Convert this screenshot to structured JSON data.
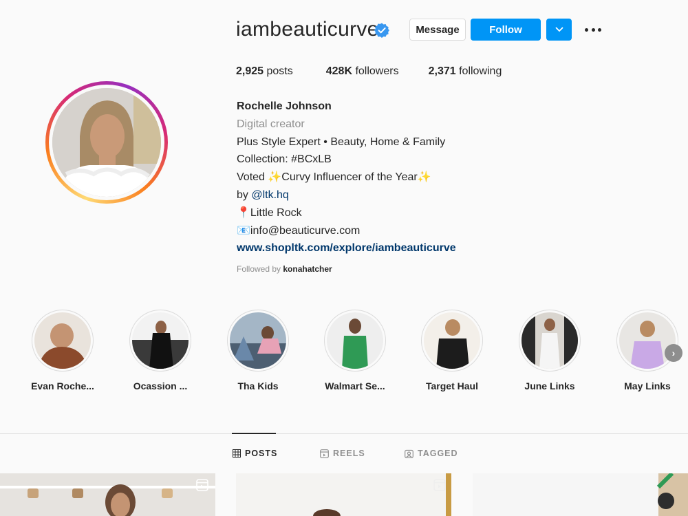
{
  "profile": {
    "username": "iambeauticurve",
    "verified": true,
    "buttons": {
      "message": "Message",
      "follow": "Follow"
    },
    "stats": {
      "posts_count": "2,925",
      "posts_label": "posts",
      "followers_count": "428K",
      "followers_label": "followers",
      "following_count": "2,371",
      "following_label": "following"
    },
    "bio": {
      "name": "Rochelle Johnson",
      "category": "Digital creator",
      "line1": "Plus Style Expert • Beauty, Home & Family",
      "line2": "Collection: #BCxLB",
      "line3_pre": "Voted ✨Curvy Influencer of the Year✨",
      "line4_pre": "by ",
      "mention": "@ltk.hq",
      "location": "📍Little Rock",
      "email": "📧info@beauticurve.com",
      "website": "www.shopltk.com/explore/iambeauticurve"
    },
    "followed_by_prefix": "Followed by ",
    "followed_by_user": "konahatcher"
  },
  "highlights": [
    {
      "label": "Evan Roche..."
    },
    {
      "label": "Ocassion ..."
    },
    {
      "label": "Tha Kids"
    },
    {
      "label": "Walmart Se..."
    },
    {
      "label": "Target Haul"
    },
    {
      "label": "June Links"
    },
    {
      "label": "May Links"
    }
  ],
  "tabs": [
    {
      "label": "POSTS",
      "icon": "grid-icon",
      "active": true
    },
    {
      "label": "REELS",
      "icon": "reels-icon",
      "active": false
    },
    {
      "label": "TAGGED",
      "icon": "tagged-icon",
      "active": false
    }
  ],
  "colors": {
    "accent": "#0095f6",
    "link": "#00376b",
    "muted": "#8e8e8e",
    "border": "#dbdbdb"
  }
}
